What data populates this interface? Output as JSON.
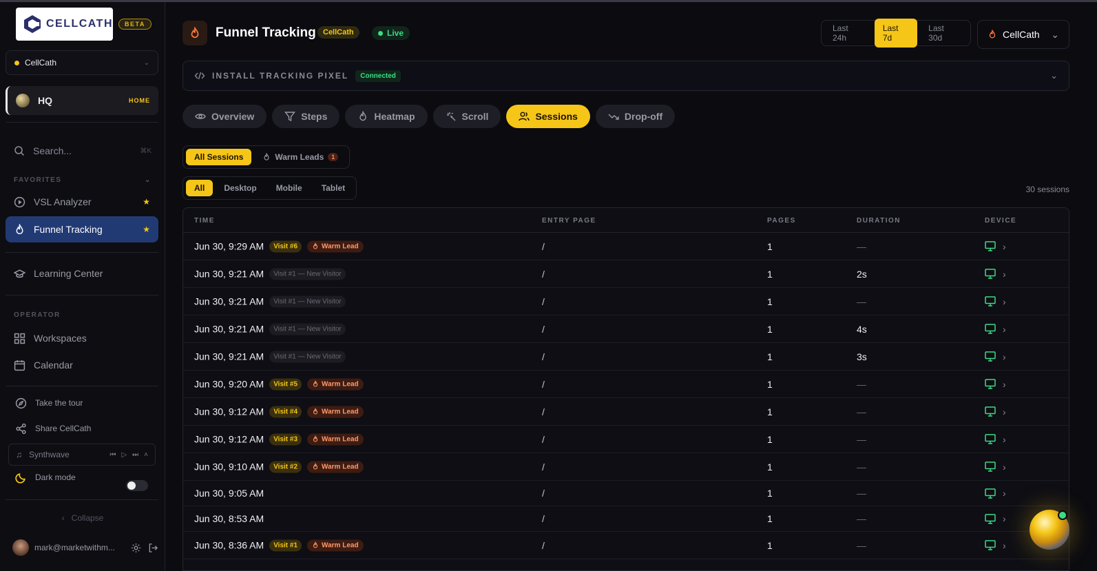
{
  "brand": {
    "name": "CELLCATH",
    "badge": "BETA"
  },
  "workspace": {
    "selected": "CellCath"
  },
  "hq": {
    "label": "HQ",
    "badge": "HOME"
  },
  "search": {
    "placeholder": "Search...",
    "shortcut": "⌘K"
  },
  "sidebar": {
    "favorites_label": "FAVORITES",
    "favorites": [
      {
        "label": "VSL Analyzer",
        "icon": "play-circle-icon",
        "starred": true
      },
      {
        "label": "Funnel Tracking",
        "icon": "flame-icon",
        "starred": true,
        "active": true
      }
    ],
    "learning": "Learning Center",
    "operator_label": "OPERATOR",
    "operator": [
      {
        "label": "Workspaces",
        "icon": "grid-icon"
      },
      {
        "label": "Calendar",
        "icon": "calendar-icon"
      }
    ],
    "tour": "Take the tour",
    "share": "Share CellCath",
    "music_track": "Synthwave",
    "dark_mode": "Dark mode",
    "collapse": "Collapse",
    "user_email": "mark@marketwithm..."
  },
  "header": {
    "title": "Funnel Tracking",
    "workspace_tag": "CellCath",
    "status": "Live",
    "ranges": [
      "Last 24h",
      "Last 7d",
      "Last 30d"
    ],
    "active_range": "Last 7d",
    "account": "CellCath"
  },
  "pixel": {
    "label": "INSTALL TRACKING PIXEL",
    "status": "Connected"
  },
  "tabs": [
    {
      "label": "Overview",
      "icon": "eye-icon"
    },
    {
      "label": "Steps",
      "icon": "filter-icon"
    },
    {
      "label": "Heatmap",
      "icon": "flame-icon"
    },
    {
      "label": "Scroll",
      "icon": "sparkle-icon"
    },
    {
      "label": "Sessions",
      "icon": "users-icon",
      "active": true
    },
    {
      "label": "Drop-off",
      "icon": "trend-down-icon"
    }
  ],
  "session_filter": {
    "all": "All Sessions",
    "warm": "Warm Leads",
    "warm_count": "1"
  },
  "device_filter": {
    "options": [
      "All",
      "Desktop",
      "Mobile",
      "Tablet"
    ],
    "active": "All"
  },
  "sessions_count": "30 sessions",
  "table": {
    "headers": {
      "time": "TIME",
      "entry": "ENTRY PAGE",
      "pages": "PAGES",
      "duration": "DURATION",
      "device": "DEVICE"
    },
    "rows": [
      {
        "time": "Jun 30, 9:29 AM",
        "visit": "Visit #6",
        "warm": "Warm Lead",
        "entry": "/",
        "pages": "1",
        "duration": "—"
      },
      {
        "time": "Jun 30, 9:21 AM",
        "visit": "Visit #1 — New Visitor",
        "warm": "",
        "entry": "/",
        "pages": "1",
        "duration": "2s"
      },
      {
        "time": "Jun 30, 9:21 AM",
        "visit": "Visit #1 — New Visitor",
        "warm": "",
        "entry": "/",
        "pages": "1",
        "duration": "—"
      },
      {
        "time": "Jun 30, 9:21 AM",
        "visit": "Visit #1 — New Visitor",
        "warm": "",
        "entry": "/",
        "pages": "1",
        "duration": "4s"
      },
      {
        "time": "Jun 30, 9:21 AM",
        "visit": "Visit #1 — New Visitor",
        "warm": "",
        "entry": "/",
        "pages": "1",
        "duration": "3s"
      },
      {
        "time": "Jun 30, 9:20 AM",
        "visit": "Visit #5",
        "warm": "Warm Lead",
        "entry": "/",
        "pages": "1",
        "duration": "—"
      },
      {
        "time": "Jun 30, 9:12 AM",
        "visit": "Visit #4",
        "warm": "Warm Lead",
        "entry": "/",
        "pages": "1",
        "duration": "—"
      },
      {
        "time": "Jun 30, 9:12 AM",
        "visit": "Visit #3",
        "warm": "Warm Lead",
        "entry": "/",
        "pages": "1",
        "duration": "—"
      },
      {
        "time": "Jun 30, 9:10 AM",
        "visit": "Visit #2",
        "warm": "Warm Lead",
        "entry": "/",
        "pages": "1",
        "duration": "—"
      },
      {
        "time": "Jun 30, 9:05 AM",
        "visit": "",
        "warm": "",
        "entry": "/",
        "pages": "1",
        "duration": "—"
      },
      {
        "time": "Jun 30, 8:53 AM",
        "visit": "",
        "warm": "",
        "entry": "/",
        "pages": "1",
        "duration": "—"
      },
      {
        "time": "Jun 30, 8:36 AM",
        "visit": "Visit #1",
        "warm": "Warm Lead",
        "entry": "/",
        "pages": "1",
        "duration": "—"
      }
    ]
  },
  "colors": {
    "accent": "#f5c518",
    "live": "#3ddc84",
    "warm": "#ff9a6c",
    "active_nav": "#223a74",
    "device": "#3ddc84"
  }
}
